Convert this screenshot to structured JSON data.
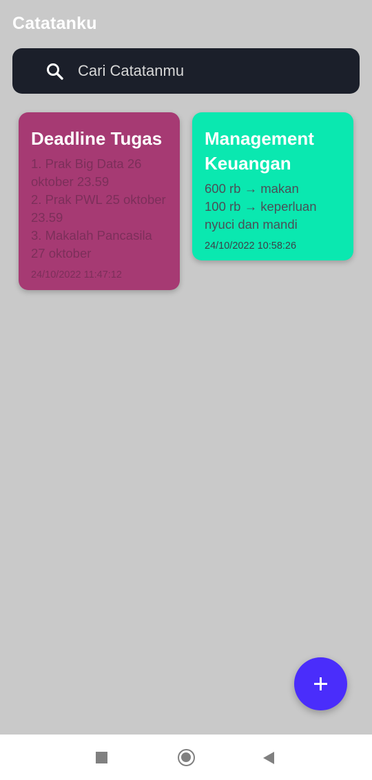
{
  "app": {
    "title": "Catatanku"
  },
  "search": {
    "placeholder": "Cari Catatanmu"
  },
  "notes": [
    {
      "title": "Deadline Tugas",
      "body": "1. Prak Big Data 26 oktober 23.59\n2. Prak PWL 25 oktober 23.59\n3. Makalah Pancasila 27 oktober",
      "date": "24/10/2022 11:47:12",
      "color": "#a63a73"
    },
    {
      "title": "Management Keuangan",
      "body": "600 rb → makan\n100 rb → keperluan nyuci dan mandi",
      "date": "24/10/2022 10:58:26",
      "color": "#0ae8b0"
    }
  ],
  "fab": {
    "icon": "plus-icon",
    "color": "#4a2dfb"
  },
  "nav": {
    "icons": [
      "recent-apps-icon",
      "home-icon",
      "back-icon"
    ]
  },
  "colors": {
    "background": "#c9c9c9",
    "search_bg": "#1b1f2a"
  }
}
